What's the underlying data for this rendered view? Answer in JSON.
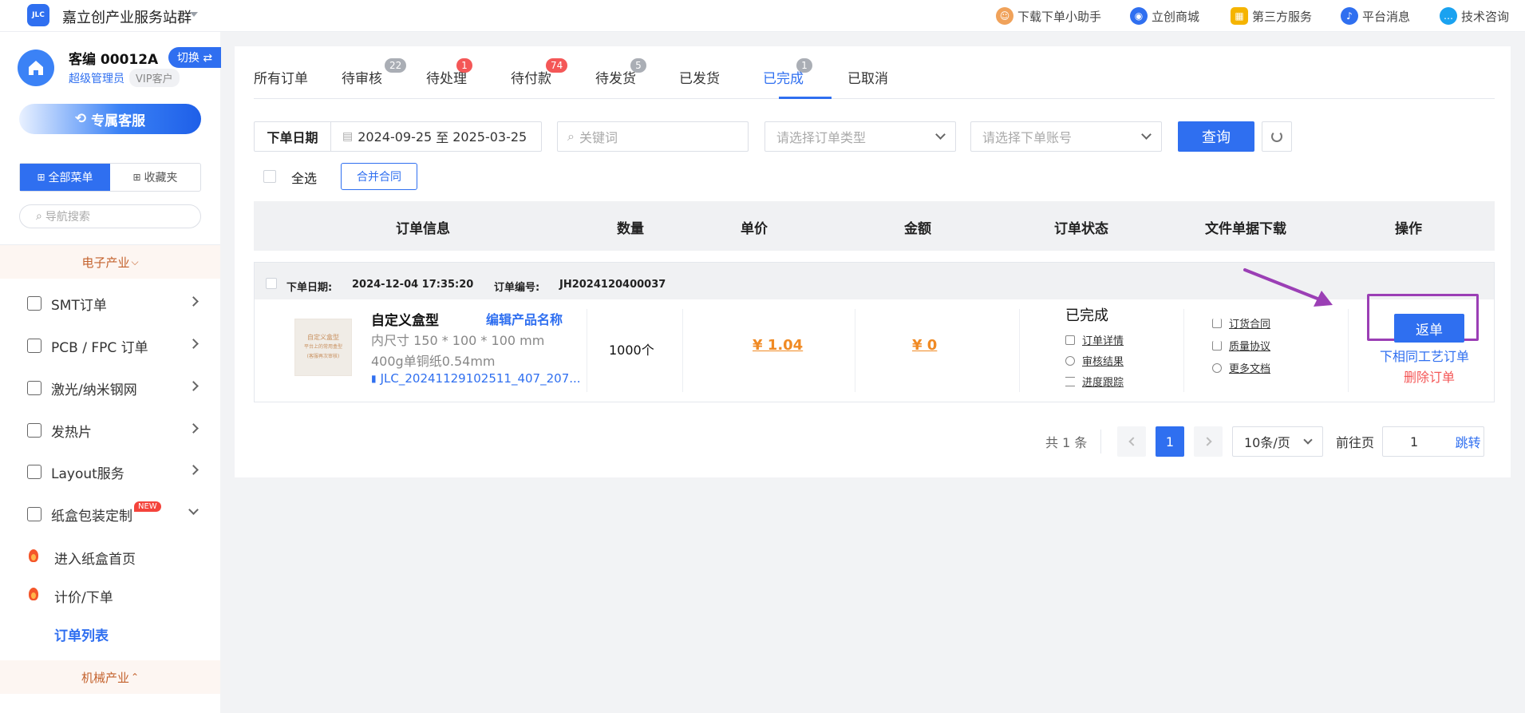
{
  "topbar": {
    "logo_text": "JLC",
    "site_title": "嘉立创产业服务站群",
    "nav": [
      {
        "label": "下载下单小助手",
        "icon": "assistant-avatar-icon"
      },
      {
        "label": "立创商城",
        "icon": "mall-icon"
      },
      {
        "label": "第三方服务",
        "icon": "grid-icon"
      },
      {
        "label": "平台消息",
        "icon": "bell-icon"
      },
      {
        "label": "技术咨询",
        "icon": "chat-icon"
      }
    ]
  },
  "sidebar": {
    "user_name": "客编 00012A",
    "switch_label": "切换 ⇄",
    "role": "超级管理员",
    "vip": "VIP客户",
    "service_button": "专属客服",
    "menu_tabs": [
      "全部菜单",
      "收藏夹"
    ],
    "search_placeholder": "导航搜索",
    "category_electronics": "电子产业",
    "items": [
      {
        "label": "SMT订单"
      },
      {
        "label": "PCB / FPC 订单"
      },
      {
        "label": "激光/纳米钢网"
      },
      {
        "label": "发热片"
      },
      {
        "label": "Layout服务"
      },
      {
        "label": "纸盒包装定制",
        "badge": "NEW"
      }
    ],
    "sub_items": [
      {
        "label": "进入纸盒首页"
      },
      {
        "label": "计价/下单"
      },
      {
        "label": "订单列表"
      }
    ],
    "category_machinery": "机械产业"
  },
  "tabs": [
    {
      "label": "所有订单",
      "badge": ""
    },
    {
      "label": "待审核",
      "badge": "22"
    },
    {
      "label": "待处理",
      "badge": "1"
    },
    {
      "label": "待付款",
      "badge": "74"
    },
    {
      "label": "待发货",
      "badge": "5"
    },
    {
      "label": "已发货",
      "badge": ""
    },
    {
      "label": "已完成",
      "badge": "1"
    },
    {
      "label": "已取消",
      "badge": ""
    }
  ],
  "filters": {
    "date_label": "下单日期",
    "date_start": "2024-09-25",
    "date_sep": "至",
    "date_end": "2025-03-25",
    "keyword_placeholder": "关键词",
    "order_type_placeholder": "请选择订单类型",
    "account_placeholder": "请选择下单账号",
    "query_button": "查询"
  },
  "bulk": {
    "select_all": "全选",
    "merge_contract": "合并合同"
  },
  "table": {
    "headers": [
      "订单信息",
      "数量",
      "单价",
      "金额",
      "订单状态",
      "文件单据下载",
      "操作"
    ]
  },
  "order": {
    "date_label": "下单日期:",
    "date_value": "2024-12-04 17:35:20",
    "no_label": "订单编号:",
    "no_value": "JH2024120400037",
    "thumb_text": [
      "自定义盒型",
      "平台上的常用盒型",
      "(客服再次审核)"
    ],
    "product_name": "自定义盒型",
    "edit_name": "编辑产品名称",
    "spec_size": "内尺寸 150 * 100 * 100 mm",
    "spec_material": "400g单铜纸0.54mm",
    "file_name": "JLC_20241129102511_407_207...",
    "quantity": "1000个",
    "unit_price": "¥ 1.04",
    "amount": "¥ 0",
    "status": "已完成",
    "status_links": [
      "订单详情",
      "审核结果",
      "进度跟踪"
    ],
    "docs": [
      "订货合同",
      "质量协议",
      "更多文档"
    ],
    "return_button": "返单",
    "reorder_link": "下相同工艺订单",
    "delete_link": "删除订单"
  },
  "pagination": {
    "total": "共 1 条",
    "current_page": "1",
    "page_size": "10条/页",
    "goto_label": "前往页",
    "goto_value": "1",
    "jump": "跳转"
  },
  "colors": {
    "accent": "#2f6ff0",
    "price": "#f08a24",
    "danger": "#f45757",
    "highlight": "#9b3fb5"
  }
}
